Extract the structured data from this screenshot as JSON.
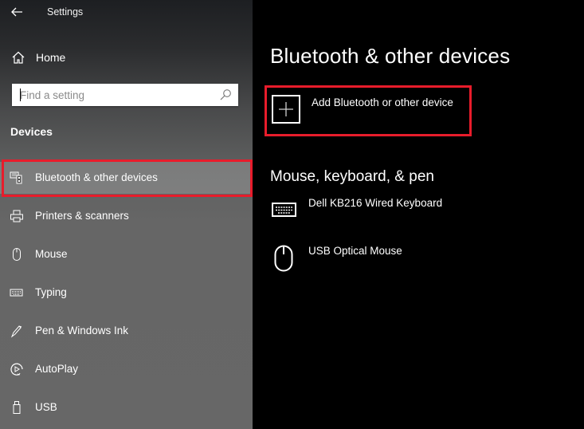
{
  "window": {
    "title": "Settings"
  },
  "sidebar": {
    "home_label": "Home",
    "search": {
      "placeholder": "Find a setting",
      "value": ""
    },
    "section_title": "Devices",
    "items": [
      {
        "label": "Bluetooth & other devices",
        "icon": "bluetooth-devices-icon",
        "selected": true
      },
      {
        "label": "Printers & scanners",
        "icon": "printer-icon",
        "selected": false
      },
      {
        "label": "Mouse",
        "icon": "mouse-icon",
        "selected": false
      },
      {
        "label": "Typing",
        "icon": "keyboard-icon",
        "selected": false
      },
      {
        "label": "Pen & Windows Ink",
        "icon": "pen-icon",
        "selected": false
      },
      {
        "label": "AutoPlay",
        "icon": "autoplay-icon",
        "selected": false
      },
      {
        "label": "USB",
        "icon": "usb-icon",
        "selected": false
      }
    ]
  },
  "main": {
    "title": "Bluetooth & other devices",
    "add_device_label": "Add Bluetooth or other device",
    "section_title": "Mouse, keyboard, & pen",
    "devices": [
      {
        "name": "Dell KB216 Wired Keyboard",
        "icon": "keyboard-icon"
      },
      {
        "name": "USB Optical Mouse",
        "icon": "mouse-icon"
      }
    ]
  },
  "colors": {
    "highlight": "#e81c2b",
    "main_background": "#000000",
    "text": "#ffffff"
  }
}
